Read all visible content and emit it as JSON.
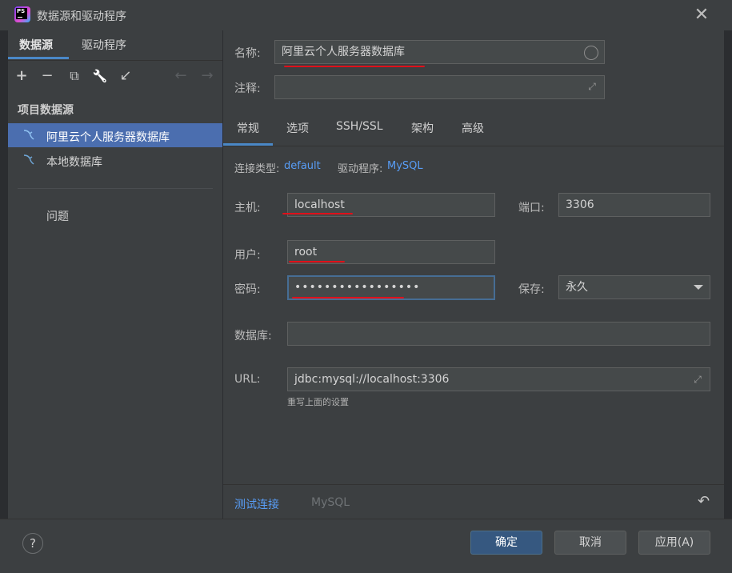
{
  "window": {
    "title": "数据源和驱动程序",
    "app_icon_text": "PS"
  },
  "sidebar": {
    "tabs": [
      {
        "label": "数据源"
      },
      {
        "label": "驱动程序"
      }
    ],
    "toolbar": {
      "add": "+",
      "remove": "−",
      "copy": "⧉",
      "wrench": "🔧",
      "import": "↙",
      "back": "←",
      "forward": "→"
    },
    "group_label": "项目数据源",
    "items": [
      {
        "label": "阿里云个人服务器数据库",
        "selected": true
      },
      {
        "label": "本地数据库",
        "selected": false
      }
    ],
    "problems": "问题"
  },
  "form": {
    "name_label": "名称:",
    "name_value": "阿里云个人服务器数据库",
    "comment_label": "注释:",
    "comment_value": "",
    "tabs": [
      {
        "label": "常规"
      },
      {
        "label": "选项"
      },
      {
        "label": "SSH/SSL"
      },
      {
        "label": "架构"
      },
      {
        "label": "高级"
      }
    ],
    "conn_type_label": "连接类型:",
    "conn_type_value": "default",
    "driver_label": "驱动程序:",
    "driver_value": "MySQL",
    "host_label": "主机:",
    "host_value": "localhost",
    "port_label": "端口:",
    "port_value": "3306",
    "user_label": "用户:",
    "user_value": "root",
    "password_label": "密码:",
    "password_value": "•••••••••••••••••",
    "save_label": "保存:",
    "save_value": "永久",
    "database_label": "数据库:",
    "database_value": "",
    "url_label": "URL:",
    "url_value": "jdbc:mysql://localhost:3306",
    "url_hint": "重写上面的设置"
  },
  "footer": {
    "test_connection": "测试连接",
    "driver_name": "MySQL",
    "reset_icon": "↶"
  },
  "buttons": {
    "help": "?",
    "ok": "确定",
    "cancel": "取消",
    "apply": "应用(A)"
  },
  "colors": {
    "accent": "#4a88c7",
    "selection": "#4b6eaf",
    "link": "#589df6",
    "annotation_red": "#e0101a"
  }
}
